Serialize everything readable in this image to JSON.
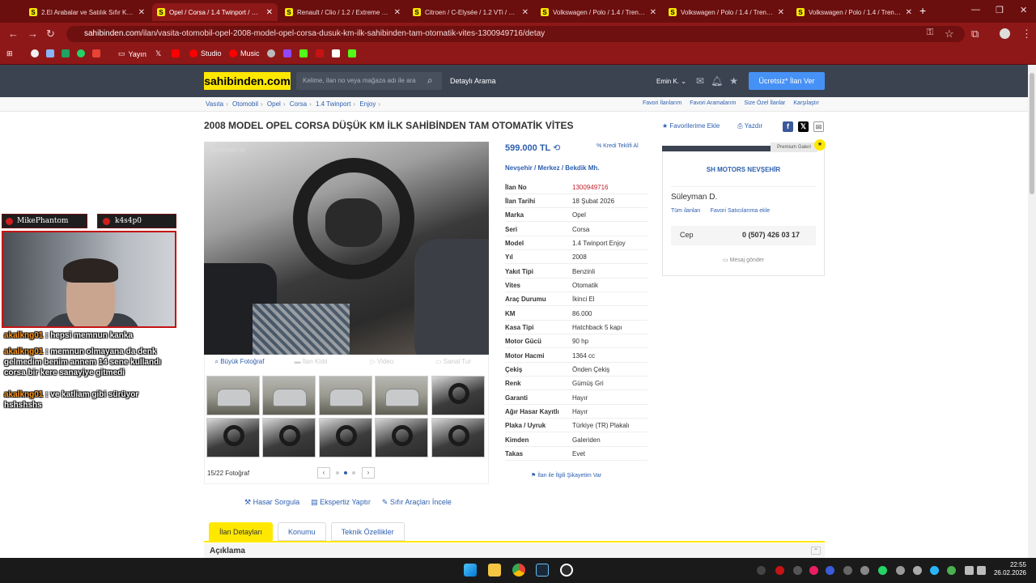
{
  "browser": {
    "tabs": [
      {
        "label": "2.El Arabalar ve Satılık Sıfır Km Araçlar",
        "active": false
      },
      {
        "label": "Opel / Corsa / 1.4 Twinport / Enjoy",
        "active": true
      },
      {
        "label": "Renault / Clio / 1.2 / Extreme / Oto",
        "active": false
      },
      {
        "label": "Citroen / C-Elysée / 1.2 VTi / Confort",
        "active": false
      },
      {
        "label": "Volkswagen / Polo / 1.4 / Trendline",
        "active": false
      },
      {
        "label": "Volkswagen / Polo / 1.4 / Trendline",
        "active": false
      },
      {
        "label": "Volkswagen / Polo / 1.4 / Trendline",
        "active": false
      }
    ],
    "url_host": "sahibinden.com",
    "url_path": "/ilan/vasita-otomobil-opel-2008-model-opel-corsa-dusuk-km-ilk-sahibinden-tam-otomatik-vites-1300949716/detay",
    "bookmarks": [
      "Yayın",
      "Studio",
      "Music"
    ]
  },
  "site": {
    "logo": "sahibinden.com",
    "search_placeholder": "Kelime, ilan no veya mağaza adı ile ara",
    "detailed_search": "Detaylı Arama",
    "user": "Emin K.",
    "post_ad": "Ücretsiz* İlan Ver"
  },
  "breadcrumb": [
    "Vasıta",
    "Otomobil",
    "Opel",
    "Corsa",
    "1.4 Twinport",
    "Enjoy"
  ],
  "breadcrumb_right": [
    "Favori İlanlarım",
    "Favori Aramalarım",
    "Size Özel İlanlar",
    "Karşılaştır"
  ],
  "listing": {
    "title": "2008 MODEL OPEL CORSA DÜŞÜK KM İLK SAHİBİNDEN TAM OTOMATİK VİTES",
    "add_favorite": "Favorilerime Ekle",
    "print": "Yazdır",
    "watermark": "#1300949716",
    "photo_tabs": [
      "Büyük Fotoğraf",
      "İlan Klıbi",
      "Video",
      "Sanal Tur"
    ],
    "photo_count": "15/22 Fotoğraf",
    "price": "599.000 TL",
    "credit": "Kredi Teklifi Al",
    "location": "Nevşehir  /  Merkez  /  Bekdik Mh.",
    "specs": [
      {
        "k": "İlan No",
        "v": "1300949716"
      },
      {
        "k": "İlan Tarihi",
        "v": "18 Şubat 2026"
      },
      {
        "k": "Marka",
        "v": "Opel"
      },
      {
        "k": "Seri",
        "v": "Corsa"
      },
      {
        "k": "Model",
        "v": "1.4 Twinport Enjoy"
      },
      {
        "k": "Yıl",
        "v": "2008"
      },
      {
        "k": "Yakıt Tipi",
        "v": "Benzinli"
      },
      {
        "k": "Vites",
        "v": "Otomatik"
      },
      {
        "k": "Araç Durumu",
        "v": "İkinci El"
      },
      {
        "k": "KM",
        "v": "86.000"
      },
      {
        "k": "Kasa Tipi",
        "v": "Hatchback 5 kapı"
      },
      {
        "k": "Motor Gücü",
        "v": "90 hp"
      },
      {
        "k": "Motor Hacmi",
        "v": "1364 cc"
      },
      {
        "k": "Çekiş",
        "v": "Önden Çekiş"
      },
      {
        "k": "Renk",
        "v": "Gümüş Gri"
      },
      {
        "k": "Garanti",
        "v": "Hayır"
      },
      {
        "k": "Ağır Hasar Kayıtlı",
        "v": "Hayır"
      },
      {
        "k": "Plaka / Uyruk",
        "v": "Türkiye (TR) Plakalı"
      },
      {
        "k": "Kimden",
        "v": "Galeriden"
      },
      {
        "k": "Takas",
        "v": "Evet"
      }
    ],
    "complaint": "İlan ile İlgili Şikayetim Var",
    "tools": [
      "Hasar Sorgula",
      "Ekspertiz Yaptır",
      "Sıfır Araçları İncele"
    ],
    "bottom_tabs": [
      "İlan Detayları",
      "Konumu",
      "Teknik Özellikler"
    ],
    "description_header": "Açıklama"
  },
  "seller": {
    "badge": "Premium Galeri",
    "store": "SH MOTORS NEVŞEHİR",
    "name": "Süleyman D.",
    "all_ads": "Tüm ilanları",
    "fav_seller": "Favori Satıcılarıma ekle",
    "phone_label": "Cep",
    "phone": "0 (507) 426 03 17",
    "message": "Mesaj gönder"
  },
  "stream": {
    "cam1": "MikePhantom",
    "cam2": "k4s4p0",
    "chat": [
      {
        "user": "akalkng01",
        "msg": ": hepsi memnun kanka"
      },
      {
        "user": "akalkng01",
        "msg": ": memnun olmayana da denk gelmedim benim annem 14 sene kullandı corsa bir kere sanayiye gitmedi"
      },
      {
        "user": "akalkng01",
        "msg": ": ve katliam gibi sürüyor hshshshs"
      }
    ]
  },
  "taskbar": {
    "time": "22:55",
    "date": "26.02.2026"
  },
  "colors": {
    "accent_yellow": "#ffe800",
    "header_dark": "#3b4351",
    "link_blue": "#2d5fae",
    "browser_red": "#8e1818"
  }
}
